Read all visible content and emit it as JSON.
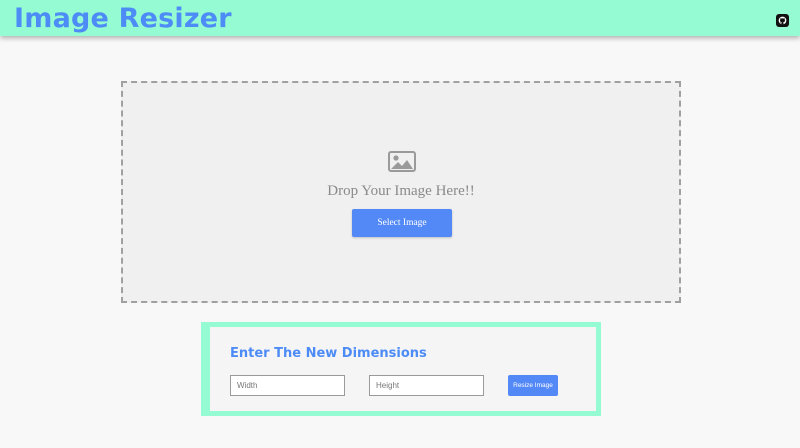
{
  "header": {
    "title": "Image Resizer",
    "github_icon": "github-icon"
  },
  "drop_zone": {
    "icon": "image-icon",
    "text": "Drop Your Image Here!!",
    "button_label": "Select Image"
  },
  "dimensions": {
    "title": "Enter The New Dimensions",
    "width_placeholder": "Width",
    "height_placeholder": "Height",
    "button_label": "Resize Image"
  },
  "colors": {
    "header_bg": "#95fbd3",
    "accent": "#4d8cf6",
    "button_bg": "#5389f7"
  }
}
